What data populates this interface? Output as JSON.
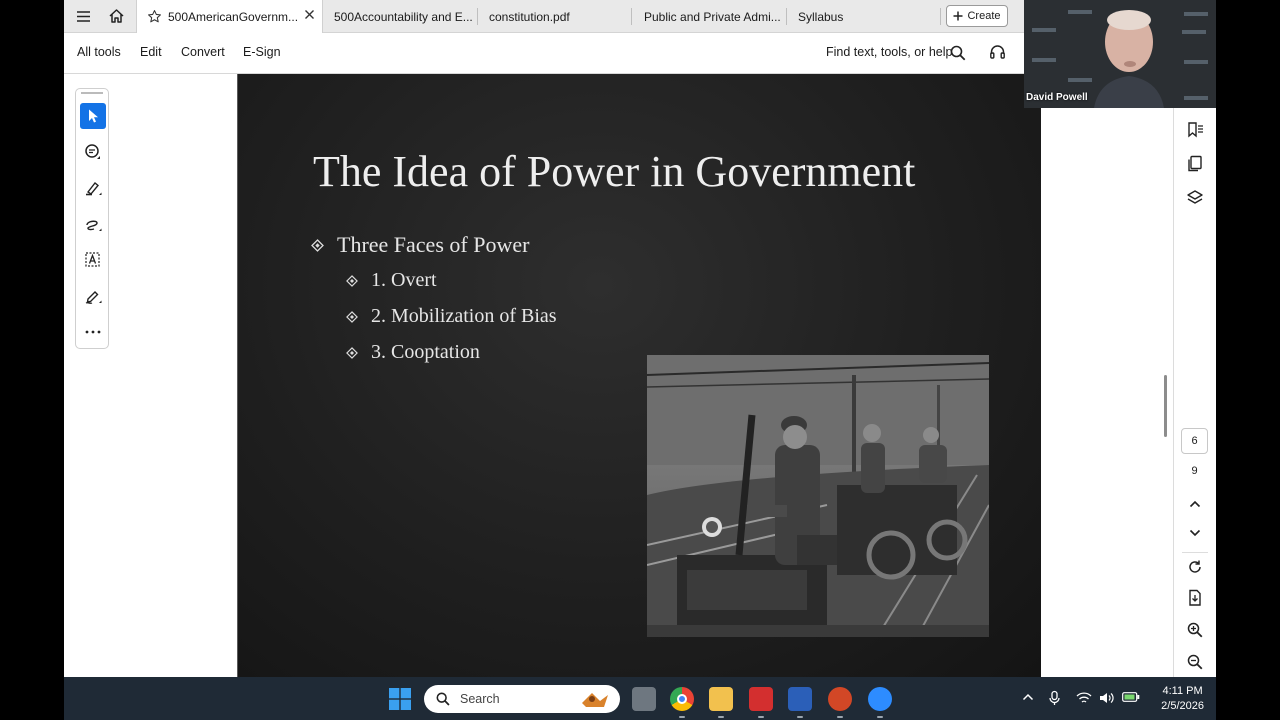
{
  "browser": {
    "tabs": [
      {
        "label": "500AmericanGovernm...",
        "active": true
      },
      {
        "label": "500Accountability and E...",
        "active": false
      },
      {
        "label": "constitution.pdf",
        "active": false
      },
      {
        "label": "Public and Private Admi...",
        "active": false
      },
      {
        "label": "Syllabus",
        "active": false
      }
    ],
    "create_label": "Create"
  },
  "toolbar": {
    "menu": [
      "All tools",
      "Edit",
      "Convert",
      "E-Sign"
    ],
    "find_label": "Find text, tools, or help"
  },
  "slide": {
    "title": "The Idea of Power in Government",
    "bullet_main": "Three Faces of Power",
    "sub_bullets": [
      "1. Overt",
      "2. Mobilization of Bias",
      "3. Cooptation"
    ]
  },
  "pagination": {
    "current": "6",
    "total": "9"
  },
  "webcam": {
    "name": "David Powell"
  },
  "taskbar": {
    "search_placeholder": "Search",
    "time": "4:11 PM",
    "date": "2/5/2026"
  },
  "colors": {
    "accent": "#1473e6",
    "slide_bg": "#222222",
    "taskbar_bg": "#1f2a36"
  }
}
